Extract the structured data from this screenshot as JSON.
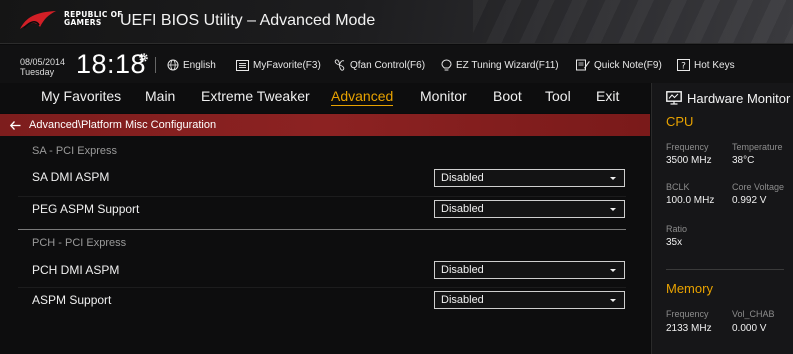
{
  "titlebar": {
    "brand_line1": "REPUBLIC OF",
    "brand_line2": "GAMERS",
    "title": "UEFI BIOS Utility – Advanced Mode"
  },
  "infobar": {
    "date": "08/05/2014",
    "day": "Tuesday",
    "time": "18:18",
    "tools": [
      {
        "label": "English",
        "icon": "globe-icon"
      },
      {
        "label": "MyFavorite(F3)",
        "icon": "favorite-list-icon"
      },
      {
        "label": "Qfan Control(F6)",
        "icon": "fan-icon"
      },
      {
        "label": "EZ Tuning Wizard(F11)",
        "icon": "bulb-icon"
      },
      {
        "label": "Quick Note(F9)",
        "icon": "note-icon"
      },
      {
        "label": "Hot Keys",
        "icon": "question-icon"
      }
    ]
  },
  "menu": {
    "items": [
      {
        "label": "My Favorites"
      },
      {
        "label": "Main"
      },
      {
        "label": "Extreme Tweaker"
      },
      {
        "label": "Advanced",
        "active": true
      },
      {
        "label": "Monitor"
      },
      {
        "label": "Boot"
      },
      {
        "label": "Tool"
      },
      {
        "label": "Exit"
      }
    ]
  },
  "breadcrumb": {
    "path": "Advanced\\Platform Misc Configuration"
  },
  "settings": {
    "sections": [
      {
        "title": "SA - PCI Express",
        "rows": [
          {
            "label": "SA DMI ASPM",
            "value": "Disabled"
          },
          {
            "label": "PEG ASPM Support",
            "value": "Disabled"
          }
        ]
      },
      {
        "title": "PCH - PCI Express",
        "rows": [
          {
            "label": "PCH DMI ASPM",
            "value": "Disabled"
          },
          {
            "label": "ASPM Support",
            "value": "Disabled"
          }
        ]
      }
    ]
  },
  "hardware_monitor": {
    "title": "Hardware Monitor",
    "cpu": {
      "title": "CPU",
      "frequency_label": "Frequency",
      "frequency": "3500 MHz",
      "temperature_label": "Temperature",
      "temperature": "38°C",
      "bclk_label": "BCLK",
      "bclk": "100.0 MHz",
      "core_voltage_label": "Core Voltage",
      "core_voltage": "0.992 V",
      "ratio_label": "Ratio",
      "ratio": "35x"
    },
    "memory": {
      "title": "Memory",
      "frequency_label": "Frequency",
      "frequency": "2133 MHz",
      "vol_label": "Vol_CHAB",
      "vol": "0.000 V"
    }
  },
  "colors": {
    "accent": "#e8a200",
    "breadcrumb_bg": "#8c2222",
    "background": "#0d0d0e"
  }
}
